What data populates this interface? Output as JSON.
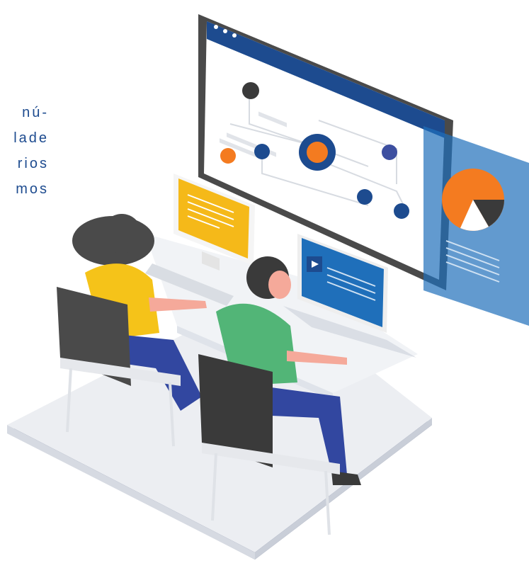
{
  "intro": {
    "lines": [
      "nú-",
      "lade",
      "rios",
      "mos"
    ]
  },
  "colors": {
    "navy": "#1d4b8f",
    "orange": "#f47b20",
    "yellow": "#f5b919",
    "blue": "#1f6fba",
    "green": "#52b577",
    "shirt_yellow": "#f5c319",
    "dark": "#3a3a3a"
  },
  "icons": {
    "window_dots": "three-dot-window-controls",
    "video": "play-icon"
  }
}
